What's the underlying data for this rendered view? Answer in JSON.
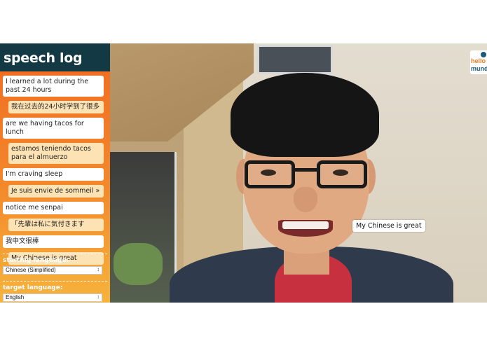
{
  "sidebar": {
    "title": "speech log",
    "log": [
      {
        "kind": "src",
        "text": "I learned a lot during the past 24 hours"
      },
      {
        "kind": "trans",
        "text": "我在过去的24小时学到了很多"
      },
      {
        "kind": "src",
        "text": "are we having tacos for lunch"
      },
      {
        "kind": "trans",
        "text": "estamos teniendo tacos para el almuerzo"
      },
      {
        "kind": "src",
        "text": "I'm craving sleep"
      },
      {
        "kind": "trans",
        "text": "Je suis envie de sommeil »"
      },
      {
        "kind": "src",
        "text": "notice me senpai"
      },
      {
        "kind": "trans",
        "text": "「先輩は私に気付きます"
      },
      {
        "kind": "src",
        "text": "我中文很棒"
      },
      {
        "kind": "trans",
        "text": "My Chinese is great"
      }
    ],
    "starting_language": {
      "label": "starting language:",
      "value": "Chinese (Simplified)"
    },
    "target_language": {
      "label": "target language:",
      "value": "English"
    }
  },
  "video": {
    "caption": "My Chinese is great",
    "logo": {
      "line1": "hello",
      "line2": "mundo"
    }
  },
  "icons": {
    "select_arrow": "updown-arrow-icon"
  },
  "colors": {
    "header": "#123944",
    "sidebar_orange": "#f06a21",
    "translation_bg": "#fde3b4"
  }
}
